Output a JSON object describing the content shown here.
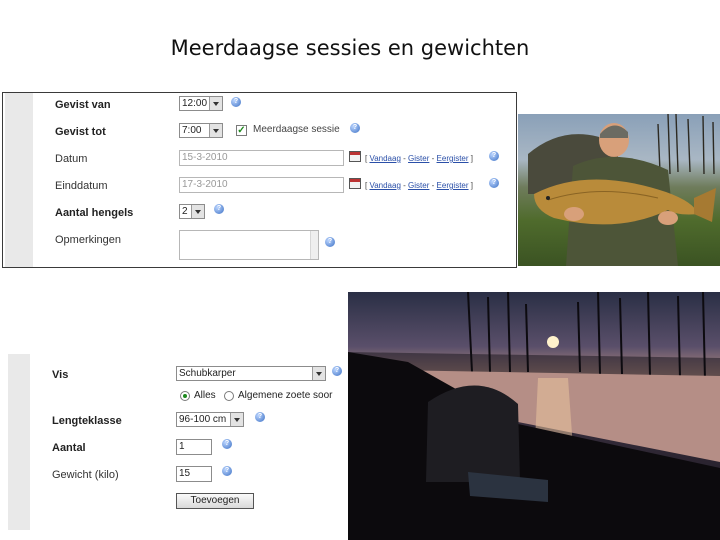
{
  "title": "Meerdaagse sessies en gewichten",
  "form1": {
    "gevist_van": {
      "label": "Gevist van",
      "value": "12:00"
    },
    "gevist_tot": {
      "label": "Gevist tot",
      "value": "7:00",
      "checkbox_label": "Meerdaagse sessie"
    },
    "datum": {
      "label": "Datum",
      "value": "15-3-2010"
    },
    "einddatum": {
      "label": "Einddatum",
      "value": "17-3-2010"
    },
    "date_links": {
      "open": "[",
      "vandaag": "Vandaag",
      "sep": "-",
      "gister": "Gister",
      "eergister": "Eergister",
      "close": "]"
    },
    "aantal_hengels": {
      "label": "Aantal hengels",
      "value": "2"
    },
    "opmerkingen": {
      "label": "Opmerkingen"
    }
  },
  "form2": {
    "vis": {
      "label": "Vis",
      "value": "Schubkarper"
    },
    "radio_alles": "Alles",
    "radio_algemene": "Algemene zoete soor",
    "lengteklasse": {
      "label": "Lengteklasse",
      "value": "96-100 cm"
    },
    "aantal": {
      "label": "Aantal",
      "value": "1"
    },
    "gewicht": {
      "label": "Gewicht (kilo)",
      "value": "15"
    },
    "toevoegen": "Toevoegen"
  },
  "colors": {
    "help_icon": "#3b6fc4",
    "link": "#2a4fa8",
    "check": "#1f8a1f"
  }
}
